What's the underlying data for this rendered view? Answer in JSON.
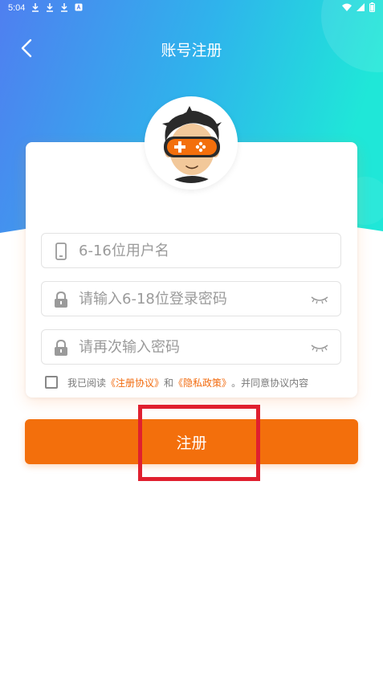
{
  "status_bar": {
    "time": "5:04"
  },
  "header": {
    "title": "账号注册",
    "back_icon": "chevron-left-icon"
  },
  "form": {
    "username": {
      "placeholder": "6-16位用户名",
      "value": ""
    },
    "password": {
      "placeholder": "请输入6-18位登录密码",
      "value": ""
    },
    "confirm_password": {
      "placeholder": "请再次输入密码",
      "value": ""
    }
  },
  "agreement": {
    "checked": false,
    "prefix": "我已阅读",
    "link1": "《注册协议》",
    "and": "和",
    "link2": "《隐私政策》",
    "suffix": "。并同意协议内容"
  },
  "submit": {
    "label": "注册"
  },
  "colors": {
    "accent": "#f36f0c",
    "link": "#f26b0f",
    "gradient_start": "#4f7ff0",
    "gradient_end": "#22e8d9",
    "highlight": "#e0202f"
  }
}
